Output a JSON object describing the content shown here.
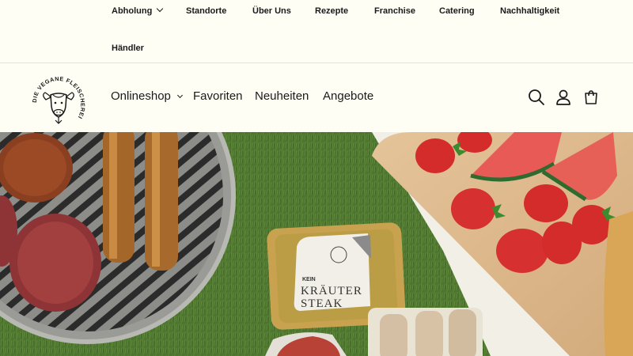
{
  "topnav": {
    "items": [
      {
        "label": "Abholung",
        "has_dropdown": true
      },
      {
        "label": "Standorte"
      },
      {
        "label": "Über Uns"
      },
      {
        "label": "Rezepte"
      },
      {
        "label": "Franchise"
      },
      {
        "label": "Catering"
      },
      {
        "label": "Nachhaltigkeit"
      },
      {
        "label": "Händler"
      }
    ]
  },
  "header": {
    "logo_text": "DIE VEGANE FLEISCHEREI",
    "nav": [
      {
        "label": "Onlineshop",
        "has_dropdown": true
      },
      {
        "label": "Favoriten"
      },
      {
        "label": "Neuheiten"
      },
      {
        "label": "Angebote"
      }
    ],
    "icons": [
      "search-icon",
      "account-icon",
      "cart-icon"
    ]
  },
  "hero": {
    "product_label_line1": "KEIN",
    "product_label_line2": "KRÄUTER",
    "product_label_line3": "STEAK"
  },
  "colors": {
    "background": "#fffef5",
    "text": "#1a1a1a",
    "grass": "#4a6e2c"
  }
}
